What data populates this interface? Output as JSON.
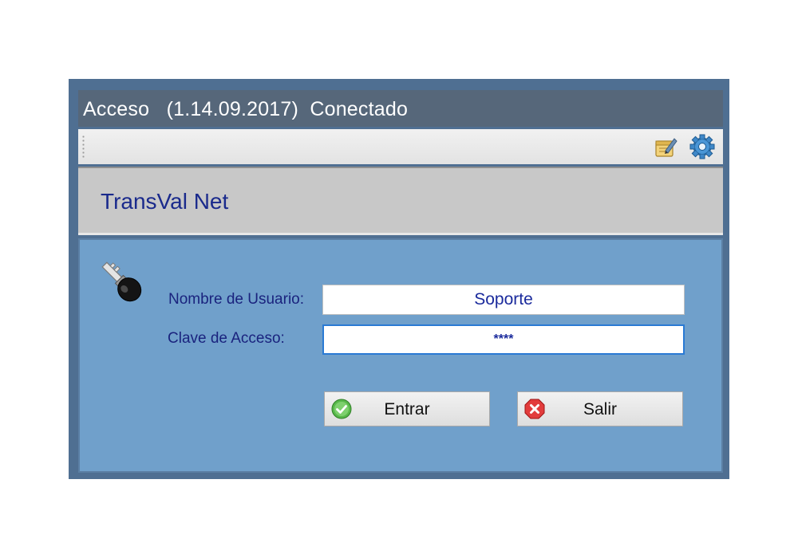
{
  "window": {
    "title": "Acceso   (1.14.09.2017)  Conectado"
  },
  "toolbar": {
    "icons": [
      "notepad-edit-icon",
      "gear-icon"
    ]
  },
  "banner": {
    "app_name": "TransVal Net"
  },
  "form": {
    "key_icon": "key-icon",
    "username_label": "Nombre de Usuario:",
    "username_value": "Soporte",
    "password_label": "Clave de Acceso:",
    "password_value": "****"
  },
  "buttons": {
    "enter_label": "Entrar",
    "enter_icon": "green-check-icon",
    "exit_label": "Salir",
    "exit_icon": "red-x-icon"
  },
  "colors": {
    "titlebar": "#56677a",
    "content_bg": "#70a0cb",
    "label_text": "#1a237e",
    "banner_bg": "#c8c8c8"
  }
}
